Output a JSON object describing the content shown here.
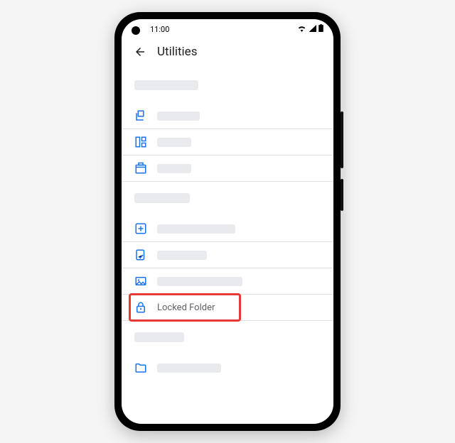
{
  "status_bar": {
    "time": "11:00",
    "icons": {
      "wifi": "wifi-icon",
      "signal": "signal-icon",
      "battery": "battery-icon"
    }
  },
  "header": {
    "back": "back-arrow-icon",
    "title": "Utilities"
  },
  "sections": [
    {
      "header_placeholder_width": 90,
      "items": [
        {
          "icon": "free-up-space-icon",
          "placeholder_width": 60
        },
        {
          "icon": "manage-storage-icon",
          "placeholder_width": 48
        },
        {
          "icon": "trash-icon",
          "placeholder_width": 48
        }
      ]
    },
    {
      "header_placeholder_width": 78,
      "items": [
        {
          "icon": "import-icon",
          "placeholder_width": 110
        },
        {
          "icon": "reorder-icon",
          "placeholder_width": 70
        },
        {
          "icon": "picture-icon",
          "placeholder_width": 120
        },
        {
          "icon": "lock-icon",
          "label": "Locked Folder",
          "highlight": true
        }
      ]
    },
    {
      "header_placeholder_width": 70,
      "items": [
        {
          "icon": "folder-icon",
          "placeholder_width": 90,
          "no_border": true
        }
      ]
    }
  ],
  "colors": {
    "icon_blue": "#1a73e8",
    "placeholder": "#e8eaed",
    "divider": "#e0e0e0",
    "highlight": "#e53935",
    "text_secondary": "#5f6368"
  }
}
